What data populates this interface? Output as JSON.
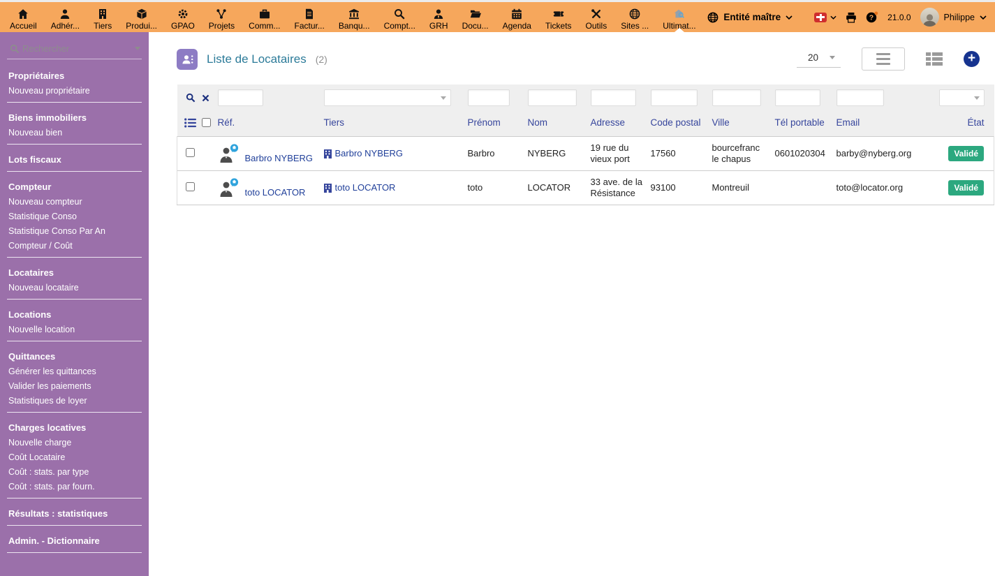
{
  "colors": {
    "topbar_bg": "#f6a75c",
    "sidebar_bg": "#9b70aa",
    "title_color": "#2c7b99",
    "header_text": "#36459c",
    "link_color": "#21409a",
    "badge_valid_bg": "#2ca87f",
    "accent_button": "#16338f"
  },
  "topbar": {
    "items": [
      {
        "label": "Accueil",
        "icon": "home-icon"
      },
      {
        "label": "Adhér...",
        "icon": "member-icon"
      },
      {
        "label": "Tiers",
        "icon": "building-icon"
      },
      {
        "label": "Produi...",
        "icon": "product-box-icon"
      },
      {
        "label": "GPAO",
        "icon": "gears-icon"
      },
      {
        "label": "Projets",
        "icon": "sitemap-icon"
      },
      {
        "label": "Comm...",
        "icon": "briefcase-icon"
      },
      {
        "label": "Factur...",
        "icon": "invoice-icon"
      },
      {
        "label": "Banqu...",
        "icon": "bank-icon"
      },
      {
        "label": "Compt...",
        "icon": "search-dollar-icon"
      },
      {
        "label": "GRH",
        "icon": "user-tie-icon"
      },
      {
        "label": "Docu...",
        "icon": "folder-icon"
      },
      {
        "label": "Agenda",
        "icon": "calendar-icon"
      },
      {
        "label": "Tickets",
        "icon": "ticket-icon"
      },
      {
        "label": "Outils",
        "icon": "tools-icon"
      },
      {
        "label": "Sites ...",
        "icon": "globe-icon"
      },
      {
        "label": "Ultimat...",
        "icon": "house-search-icon",
        "active": true
      }
    ],
    "entity_label": "Entité maître",
    "flag": "swiss-flag-icon",
    "version": "21.0.0",
    "user": "Philippe"
  },
  "sidebar": {
    "search_placeholder": "Rechercher",
    "sections": [
      {
        "title": "Propriétaires",
        "links": [
          "Nouveau propriétaire"
        ]
      },
      {
        "title": "Biens immobiliers",
        "links": [
          "Nouveau bien"
        ]
      },
      {
        "title": "Lots fiscaux",
        "links": []
      },
      {
        "title": "Compteur",
        "links": [
          "Nouveau compteur",
          "Statistique Conso",
          "Statistique Conso Par An",
          "Compteur / Coût"
        ]
      },
      {
        "title": "Locataires",
        "links": [
          "Nouveau locataire"
        ]
      },
      {
        "title": "Locations",
        "links": [
          "Nouvelle location"
        ]
      },
      {
        "title": "Quittances",
        "links": [
          "Générer les quittances",
          "Valider les paiements",
          "Statistiques de loyer"
        ]
      },
      {
        "title": "Charges locatives",
        "links": [
          "Nouvelle charge",
          "Coût Locataire",
          "Coût : stats. par type",
          "Coût : stats. par fourn."
        ]
      },
      {
        "title": "Résultats : statistiques",
        "links": []
      },
      {
        "title": "Admin. - Dictionnaire",
        "links": []
      }
    ]
  },
  "main": {
    "title": "Liste de Locataires",
    "count": "(2)",
    "page_size": "20",
    "columns": [
      "Réf.",
      "Tiers",
      "Prénom",
      "Nom",
      "Adresse",
      "Code postal",
      "Ville",
      "Tél portable",
      "Email",
      "État"
    ],
    "rows": [
      {
        "ref": "Barbro NYBERG",
        "tiers": "Barbro NYBERG",
        "prenom": "Barbro",
        "nom": "NYBERG",
        "adresse": "19 rue du vieux port",
        "code_postal": "17560",
        "ville": "bourcefranc le chapus",
        "tel": "0601020304",
        "email": "barby@nyberg.org",
        "etat": "Validé"
      },
      {
        "ref": "toto LOCATOR",
        "tiers": "toto LOCATOR",
        "prenom": "toto",
        "nom": "LOCATOR",
        "adresse": "33 ave. de la Résistance",
        "code_postal": "93100",
        "ville": "Montreuil",
        "tel": "",
        "email": "toto@locator.org",
        "etat": "Validé"
      }
    ]
  }
}
